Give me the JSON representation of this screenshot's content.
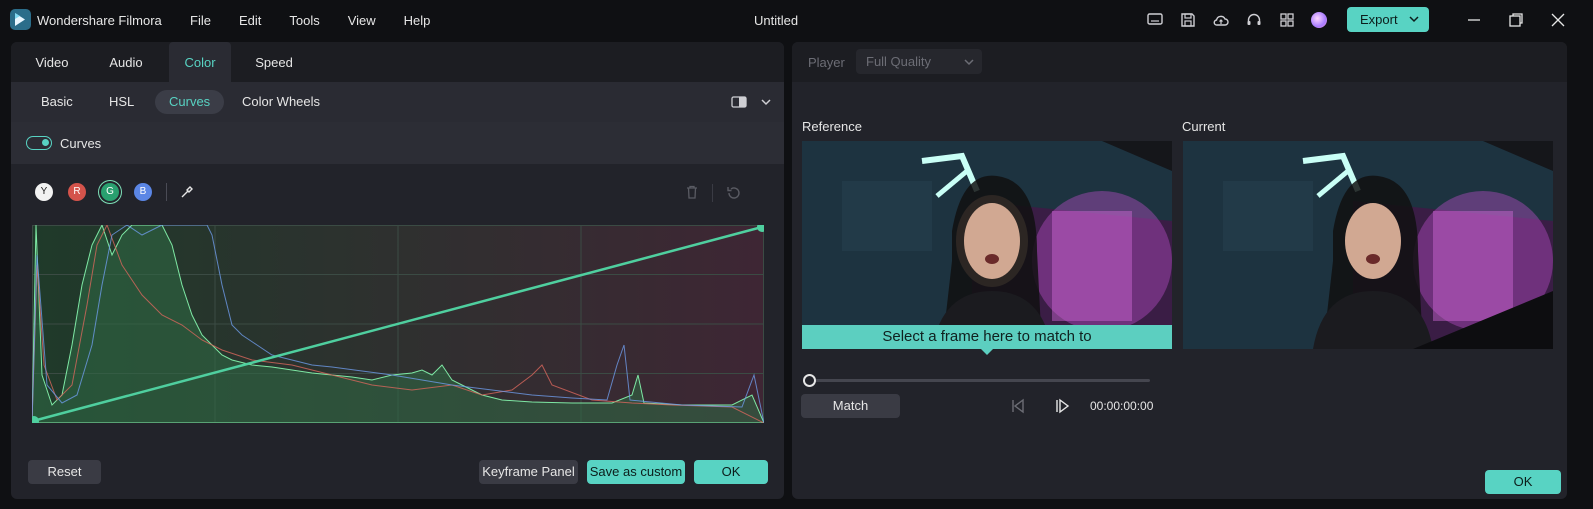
{
  "app": {
    "name": "Wondershare Filmora",
    "document_title": "Untitled",
    "menu": [
      "File",
      "Edit",
      "Tools",
      "View",
      "Help"
    ],
    "export_label": "Export",
    "colors": {
      "accent": "#58d3c3",
      "background": "#0f1013",
      "panel": "#22232a"
    }
  },
  "left_panel": {
    "tabs": [
      "Video",
      "Audio",
      "Color",
      "Speed"
    ],
    "active_tab": "Color",
    "subtabs": [
      "Basic",
      "HSL",
      "Curves",
      "Color Wheels"
    ],
    "active_subtab": "Curves",
    "section_title": "Curves",
    "section_enabled": true,
    "channels": [
      "Y",
      "R",
      "G",
      "B"
    ],
    "active_channel": "G",
    "buttons": {
      "reset": "Reset",
      "keyframe": "Keyframe Panel",
      "save_custom": "Save as custom",
      "ok": "OK"
    }
  },
  "right_panel": {
    "player_label": "Player",
    "quality": "Full Quality",
    "reference_label": "Reference",
    "current_label": "Current",
    "banner": "Select a frame here to match to",
    "match_button": "Match",
    "timecode": "00:00:00:00",
    "ok": "OK",
    "scrub_position": 0
  }
}
